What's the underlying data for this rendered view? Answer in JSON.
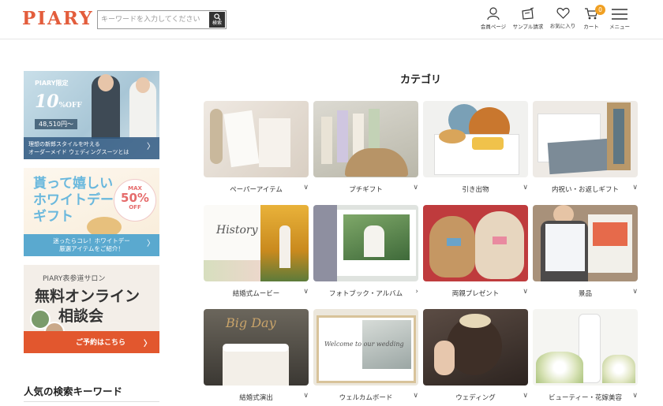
{
  "header": {
    "logo": "PIARY",
    "search_placeholder": "キーワードを入力してください",
    "search_button": "検索",
    "nav": {
      "member": "会員ページ",
      "sample": "サンプル請求",
      "favorite": "お気に入り",
      "cart": "カート",
      "menu": "メニュー",
      "cart_count": "0"
    }
  },
  "sidebar": {
    "banner1": {
      "tag": "PIARY限定",
      "off_num": "10",
      "off_text": "%OFF",
      "price": "48,510円〜",
      "line1": "理想の新郎スタイルを叶える",
      "line2": "オーダーメイド ウェディングスーツとは"
    },
    "banner2": {
      "line1": "貰って嬉しい",
      "line2": "ホワイトデー",
      "line3": "ギフト",
      "max": "MAX",
      "pct": "50%",
      "off": "OFF",
      "foot1": "迷ったらコレ！ホワイトデー",
      "foot2": "厳選アイテムをご紹介！"
    },
    "banner3": {
      "salon": "PIARY表参道サロン",
      "line1": "無料オンライン",
      "line2": "相談会",
      "cta": "ご予約はこちら"
    },
    "popular_title": "人気の検索キーワード"
  },
  "categories": {
    "title": "カテゴリ",
    "items": [
      {
        "label": "ペーパーアイテム",
        "chev": "∨"
      },
      {
        "label": "プチギフト",
        "chev": "∨"
      },
      {
        "label": "引き出物",
        "chev": "∨"
      },
      {
        "label": "内祝い・お返しギフト",
        "chev": "∨"
      },
      {
        "label": "結婚式ムービー",
        "chev": "∨"
      },
      {
        "label": "フォトブック・アルバム",
        "chev": "›"
      },
      {
        "label": "両親プレゼント",
        "chev": "∨"
      },
      {
        "label": "景品",
        "chev": "∨"
      },
      {
        "label": "結婚式演出",
        "chev": "∨"
      },
      {
        "label": "ウェルカムボード",
        "chev": "∨"
      },
      {
        "label": "ウェディング",
        "chev": "∨"
      },
      {
        "label": "ビューティー・花嫁美容",
        "chev": "∨"
      }
    ]
  },
  "colors": {
    "brand": "#e35d3c",
    "cart_badge": "#f0a023"
  }
}
